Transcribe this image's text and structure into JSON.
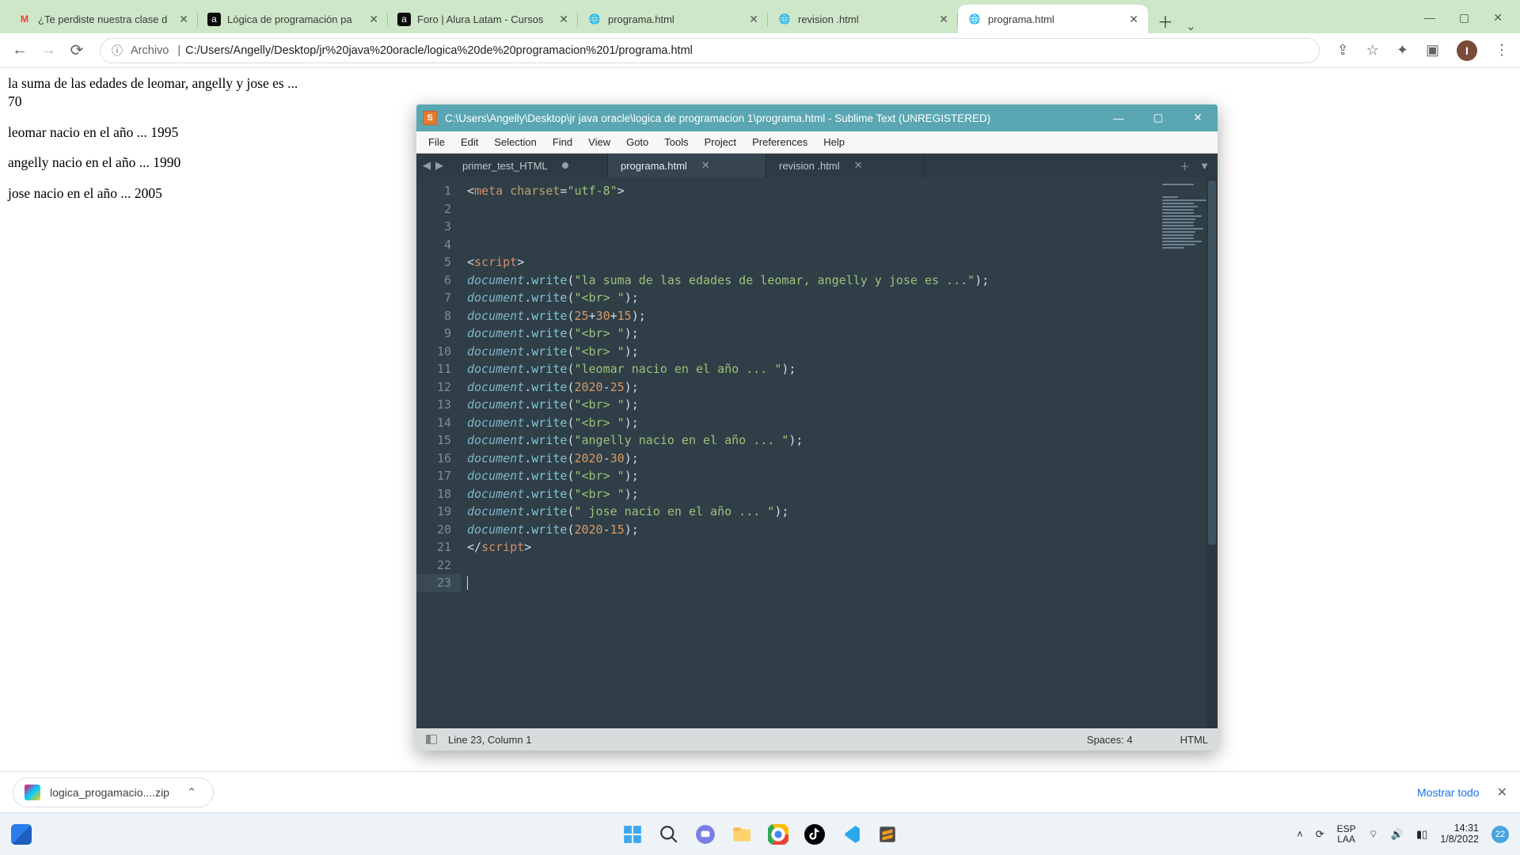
{
  "browser": {
    "tabs": [
      {
        "title": "¿Te perdiste nuestra clase d",
        "icon": "M",
        "icon_bg": "#fff",
        "icon_color": "#ea4335"
      },
      {
        "title": "Lógica de programación pa",
        "icon": "a",
        "icon_bg": "#0b0b0b",
        "icon_color": "#fff"
      },
      {
        "title": "Foro | Alura Latam - Cursos",
        "icon": "a",
        "icon_bg": "#0b0b0b",
        "icon_color": "#fff"
      },
      {
        "title": "programa.html",
        "icon": "◐",
        "icon_bg": "",
        "icon_color": "#6e6e6e"
      },
      {
        "title": "revision .html",
        "icon": "◐",
        "icon_bg": "",
        "icon_color": "#6e6e6e"
      },
      {
        "title": "programa.html",
        "icon": "◐",
        "icon_bg": "",
        "icon_color": "#6e6e6e",
        "active": true
      }
    ],
    "omnibox": {
      "label": "Archivo",
      "url": "C:/Users/Angelly/Desktop/jr%20java%20oracle/logica%20de%20programacion%201/programa.html"
    }
  },
  "page": {
    "line1": "la suma de las edades de leomar, angelly y jose es ...",
    "line2": "70",
    "line3": "leomar nacio en el año ... 1995",
    "line4": "angelly nacio en el año ... 1990",
    "line5": "jose nacio en el año ... 2005"
  },
  "sublime": {
    "title": "C:\\Users\\Angelly\\Desktop\\jr java oracle\\logica de programacion 1\\programa.html - Sublime Text (UNREGISTERED)",
    "menus": [
      "File",
      "Edit",
      "Selection",
      "Find",
      "View",
      "Goto",
      "Tools",
      "Project",
      "Preferences",
      "Help"
    ],
    "tabs": [
      {
        "name": "primer_test_HTML",
        "dirty": true
      },
      {
        "name": "programa.html",
        "active": true
      },
      {
        "name": "revision .html"
      }
    ],
    "status": {
      "pos": "Line 23, Column 1",
      "spaces": "Spaces: 4",
      "syntax": "HTML"
    },
    "code_lines": 23
  },
  "downloads": {
    "item": "logica_progamacio....zip",
    "show_all": "Mostrar todo"
  },
  "taskbar": {
    "kbd1": "ESP",
    "kbd2": "LAA",
    "time": "14:31",
    "date": "1/8/2022",
    "noti_count": "22"
  }
}
